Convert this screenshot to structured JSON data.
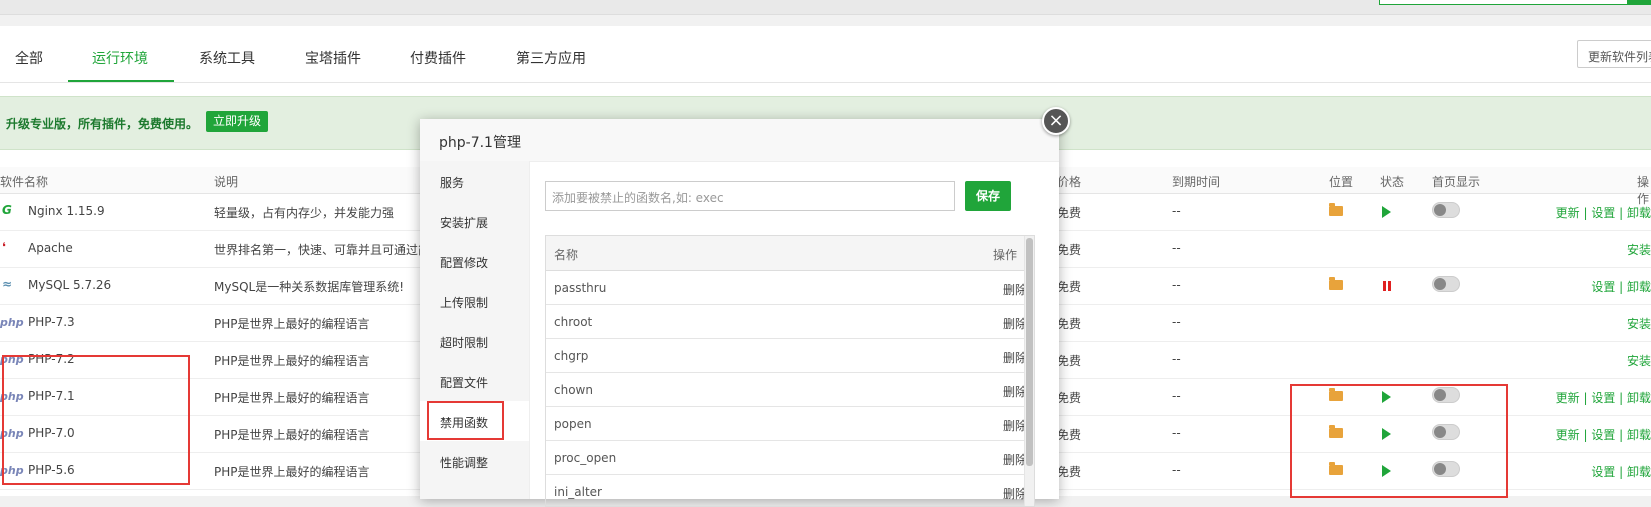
{
  "tabs": [
    {
      "label": "全部"
    },
    {
      "label": "运行环境"
    },
    {
      "label": "系统工具"
    },
    {
      "label": "宝塔插件"
    },
    {
      "label": "付费插件"
    },
    {
      "label": "第三方应用"
    }
  ],
  "update_button": "更新软件列表",
  "promo": {
    "text": "升级专业版，所有插件，免费使用。",
    "button": "立即升级"
  },
  "table_headers": {
    "name": "软件名称",
    "desc": "说明",
    "price": "价格",
    "expire": "到期时间",
    "location": "位置",
    "status": "状态",
    "homepage": "首页显示",
    "ops": "操作"
  },
  "rows": [
    {
      "icon": "nginx",
      "name": "Nginx 1.15.9",
      "desc": "轻量级，占有内存少，并发能力强",
      "price": "免费",
      "expire": "--",
      "actions": "更新 | 设置 | 卸载"
    },
    {
      "icon": "apache",
      "name": "Apache",
      "desc": "世界排名第一，快速、可靠并且可通过简单的API扩充",
      "price": "免费",
      "expire": "--",
      "actions": "安装"
    },
    {
      "icon": "mysql",
      "name": "MySQL 5.7.26",
      "desc": "MySQL是一种关系数据库管理系统!",
      "price": "免费",
      "expire": "--",
      "actions": "设置 | 卸载"
    },
    {
      "icon": "php",
      "name": "PHP-7.3",
      "desc": "PHP是世界上最好的编程语言",
      "price": "免费",
      "expire": "--",
      "actions": "安装"
    },
    {
      "icon": "php",
      "name": "PHP-7.2",
      "desc": "PHP是世界上最好的编程语言",
      "price": "免费",
      "expire": "--",
      "actions": "安装"
    },
    {
      "icon": "php",
      "name": "PHP-7.1",
      "desc": "PHP是世界上最好的编程语言",
      "price": "免费",
      "expire": "--",
      "actions": "更新 | 设置 | 卸载"
    },
    {
      "icon": "php",
      "name": "PHP-7.0",
      "desc": "PHP是世界上最好的编程语言",
      "price": "免费",
      "expire": "--",
      "actions": "更新 | 设置 | 卸载"
    },
    {
      "icon": "php",
      "name": "PHP-5.6",
      "desc": "PHP是世界上最好的编程语言",
      "price": "免费",
      "expire": "--",
      "actions": "设置 | 卸载"
    }
  ],
  "icons": {
    "php": "php",
    "nginx": "G",
    "apache": "❛",
    "mysql": "≈"
  },
  "modal": {
    "title": "php-7.1管理",
    "close": "×",
    "menu": [
      {
        "label": "服务"
      },
      {
        "label": "安装扩展"
      },
      {
        "label": "配置修改"
      },
      {
        "label": "上传限制"
      },
      {
        "label": "超时限制"
      },
      {
        "label": "配置文件"
      },
      {
        "label": "禁用函数"
      },
      {
        "label": "性能调整"
      }
    ],
    "input_placeholder": "添加要被禁止的函数名,如: exec",
    "save_label": "保存",
    "table_head": {
      "name": "名称",
      "op": "操作"
    },
    "functions": [
      {
        "name": "passthru",
        "op": "删除"
      },
      {
        "name": "chroot",
        "op": "删除"
      },
      {
        "name": "chgrp",
        "op": "删除"
      },
      {
        "name": "chown",
        "op": "删除"
      },
      {
        "name": "popen",
        "op": "删除"
      },
      {
        "name": "proc_open",
        "op": "删除"
      },
      {
        "name": "ini_alter",
        "op": "删除"
      }
    ]
  },
  "colors": {
    "accent": "#20a53a",
    "danger": "#e53935"
  }
}
